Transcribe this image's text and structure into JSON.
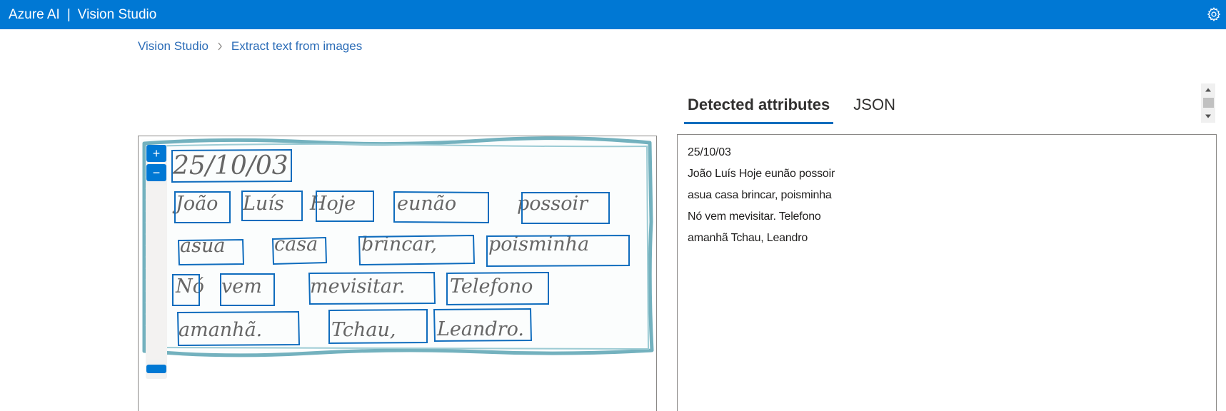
{
  "app": {
    "brand": "Azure AI",
    "separator": "|",
    "product": "Vision Studio",
    "settings_icon": "gear-icon"
  },
  "breadcrumb": {
    "items": [
      "Vision Studio",
      "Extract text from images"
    ],
    "separator_icon": "chevron-right-icon"
  },
  "image_viewer": {
    "zoom_in_label": "+",
    "zoom_out_label": "−",
    "handwriting": {
      "date": "25/10/03",
      "lines": [
        [
          "João",
          "Luís",
          "Hoje",
          "eunão",
          "possoir"
        ],
        [
          "asua",
          "casa",
          "brincar,",
          "poisminha"
        ],
        [
          "Nó",
          "vem",
          "mevisitar.",
          "Telefono"
        ],
        [
          "amanhã.",
          "Tchau,",
          "Leandro."
        ]
      ]
    },
    "colors": {
      "box": "#0f6cbd",
      "border_scribble": "#5ba3b3",
      "ink": "#555555"
    }
  },
  "tabs": [
    {
      "label": "Detected attributes",
      "active": true
    },
    {
      "label": "JSON",
      "active": false
    }
  ],
  "detected_text": {
    "lines": [
      "25/10/03",
      "João Luís Hoje eunão possoir",
      "asua casa brincar, poisminha",
      "Nó vem mevisitar. Telefono",
      "amanhã Tchau, Leandro"
    ]
  },
  "colors": {
    "accent": "#0078d4",
    "link": "#2b6cb7",
    "border": "#8a8886"
  }
}
